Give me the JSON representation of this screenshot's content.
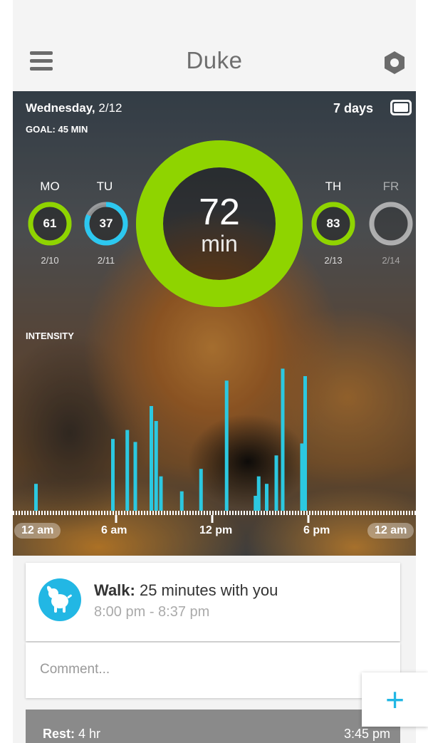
{
  "header": {
    "title": "Duke",
    "menu_icon": "hamburger-menu-icon",
    "settings_icon": "hexagon-settings-icon"
  },
  "summary": {
    "date_bold": "Wednesday,",
    "date_rest": " 2/12",
    "goal": "GOAL: 45 MIN",
    "range_label": "7 days",
    "range_icon": "calendar-toggle-icon"
  },
  "days": [
    {
      "name": "MO",
      "date": "2/10",
      "value": "61",
      "progress": 1.0,
      "color": "#8fd400"
    },
    {
      "name": "TU",
      "date": "2/11",
      "value": "37",
      "progress": 0.82,
      "color": "#2cc8f0"
    },
    {
      "name": "WE",
      "date": "2/12",
      "value": "72",
      "unit": "min",
      "progress": 1.0,
      "color": "#8fd400"
    },
    {
      "name": "TH",
      "date": "2/13",
      "value": "83",
      "progress": 1.0,
      "color": "#8fd400"
    },
    {
      "name": "FR",
      "date": "2/14",
      "value": "",
      "progress": 0,
      "color": "#bfbfbf"
    }
  ],
  "intensity_label": "INTENSITY",
  "time_labels": [
    "12 am",
    "6 am",
    "12 pm",
    "6 pm",
    "12 am"
  ],
  "chart_data": {
    "type": "bar",
    "title": "",
    "series": [
      {
        "values_x_hours": [
          1.0,
          5.8,
          6.7,
          7.2,
          8.2,
          8.5,
          8.8,
          10.1,
          11.3,
          12.9,
          14.7,
          14.9,
          15.4,
          16.0,
          16.4,
          17.6,
          17.8
        ],
        "values_intensity": [
          0.18,
          0.48,
          0.54,
          0.46,
          0.7,
          0.6,
          0.23,
          0.13,
          0.28,
          0.87,
          0.1,
          0.23,
          0.18,
          0.37,
          0.95,
          0.45,
          0.9
        ]
      }
    ],
    "x_unit": "hour of day",
    "xlim": [
      0,
      24
    ],
    "ylim": [
      0,
      1
    ],
    "bar_color": "#2cc8e0"
  },
  "activity": {
    "type": "Walk:",
    "summary": " 25 minutes with you",
    "time": "8:00 pm - 8:37 pm",
    "icon": "dog-walk-icon",
    "comment_placeholder": "Comment..."
  },
  "rest": {
    "type": "Rest:",
    "duration": " 4 hr",
    "time": "3:45 pm"
  },
  "add_button": "+"
}
